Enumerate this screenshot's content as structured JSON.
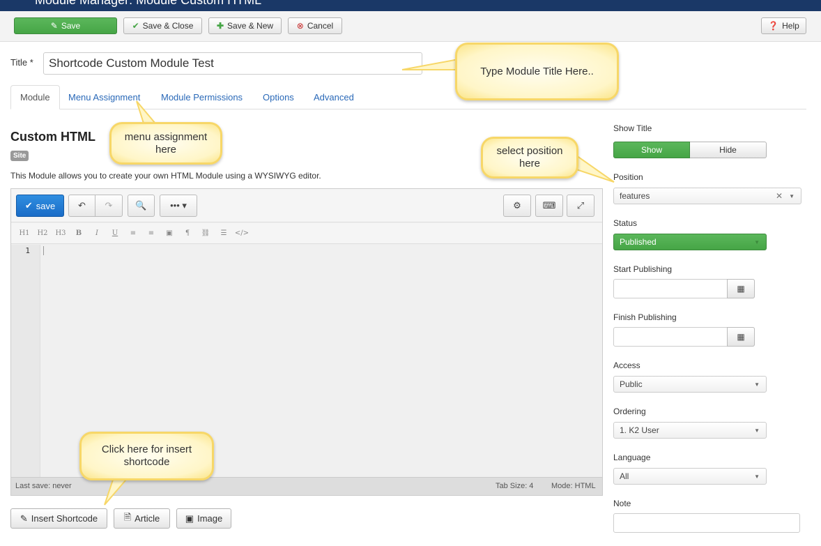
{
  "header": {
    "title": "Module Manager: Module Custom HTML"
  },
  "toolbar": {
    "save": "Save",
    "save_close": "Save & Close",
    "save_new": "Save & New",
    "cancel": "Cancel",
    "help": "Help"
  },
  "title_field": {
    "label": "Title *",
    "value": "Shortcode Custom Module Test"
  },
  "tabs": [
    "Module",
    "Menu Assignment",
    "Module Permissions",
    "Options",
    "Advanced"
  ],
  "module": {
    "name": "Custom HTML",
    "badge": "Site",
    "description": "This Module allows you to create your own HTML Module using a WYSIWYG editor."
  },
  "editor": {
    "save": "save",
    "format": [
      "H1",
      "H2",
      "H3",
      "B",
      "I",
      "U",
      "≡",
      "≡",
      "▣",
      "¶",
      "⛓",
      "☰",
      "</>"
    ],
    "line": "1",
    "last_save": "Last save: never",
    "tab_size": "Tab Size: 4",
    "mode": "Mode: HTML"
  },
  "bottom_buttons": {
    "insert_shortcode": "Insert Shortcode",
    "article": "Article",
    "image": "Image"
  },
  "sidebar": {
    "show_title": {
      "label": "Show Title",
      "on": "Show",
      "off": "Hide",
      "selected": "Show"
    },
    "position": {
      "label": "Position",
      "value": "features"
    },
    "status": {
      "label": "Status",
      "value": "Published"
    },
    "start_publishing": {
      "label": "Start Publishing",
      "value": ""
    },
    "finish_publishing": {
      "label": "Finish Publishing",
      "value": ""
    },
    "access": {
      "label": "Access",
      "value": "Public"
    },
    "ordering": {
      "label": "Ordering",
      "value": "1. K2 User"
    },
    "language": {
      "label": "Language",
      "value": "All"
    },
    "note": {
      "label": "Note",
      "value": ""
    }
  },
  "callouts": {
    "title": "Type Module Title Here..",
    "menu": "menu assignment here",
    "position": "select position here",
    "shortcode": "Click here for insert shortcode"
  },
  "colors": {
    "header": "#1a3867",
    "green": "#46a546",
    "blue": "#1a6cc7",
    "link": "#2a69b8",
    "bubble": "#fff6c8"
  }
}
